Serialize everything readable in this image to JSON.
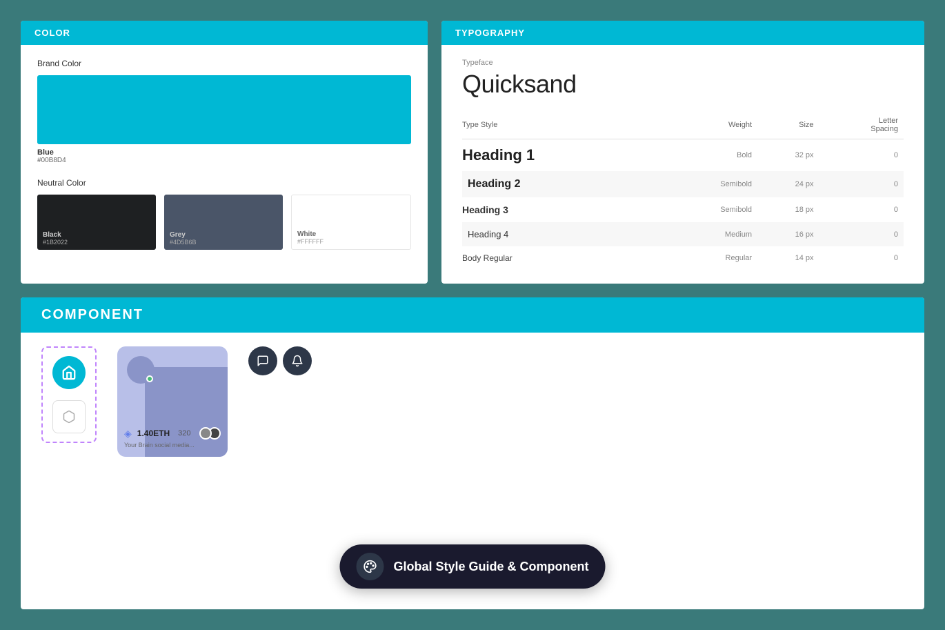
{
  "color_panel": {
    "header": "COLOR",
    "brand_section_label": "Brand Color",
    "brand_swatches": [
      {
        "name": "Blue",
        "hex": "#00b8d4",
        "display_hex": "#00B8D4",
        "color": "#00b8d4"
      }
    ],
    "neutral_section_label": "Neutral Color",
    "neutral_swatches": [
      {
        "name": "Black",
        "hex": "#1B2022",
        "display_hex": "#1B2022",
        "class": "black"
      },
      {
        "name": "Grey",
        "hex": "#4D5B6B",
        "display_hex": "#4D5B6B",
        "class": "grey"
      },
      {
        "name": "White",
        "hex": "#FFFFFF",
        "display_hex": "#FFFFFF",
        "class": "white"
      }
    ]
  },
  "typography_panel": {
    "header": "TYPOGRAPHY",
    "typeface_label": "Typeface",
    "typeface_name": "Quicksand",
    "table": {
      "columns": [
        "Type Style",
        "Weight",
        "Size",
        "Letter Spacing"
      ],
      "rows": [
        {
          "style": "Heading 1",
          "weight": "Bold",
          "size": "32 px",
          "letter_spacing": "0",
          "class": "h1",
          "shaded": false
        },
        {
          "style": "Heading 2",
          "weight": "Semibold",
          "size": "24 px",
          "letter_spacing": "0",
          "class": "h2",
          "shaded": true
        },
        {
          "style": "Heading 3",
          "weight": "Semibold",
          "size": "18 px",
          "letter_spacing": "0",
          "class": "h3",
          "shaded": false
        },
        {
          "style": "Heading 4",
          "weight": "Medium",
          "size": "16 px",
          "letter_spacing": "0",
          "class": "h4",
          "shaded": true
        },
        {
          "style": "Body Regular",
          "weight": "Regular",
          "size": "14 px",
          "letter_spacing": "0",
          "class": "body-reg",
          "shaded": false
        }
      ]
    }
  },
  "component_panel": {
    "header": "COMPONENT",
    "badge_text": "Global Style Guide & Component",
    "eth_amount": "1.40ETH",
    "eth_count": "320",
    "eth_caption": "Your Brain social media...",
    "icon_btns": [
      {
        "icon": "💬",
        "name": "chat-icon"
      },
      {
        "icon": "🔔",
        "name": "bell-icon"
      }
    ]
  },
  "accent_color": "#00b8d4",
  "bg_color": "#3a7a7a"
}
